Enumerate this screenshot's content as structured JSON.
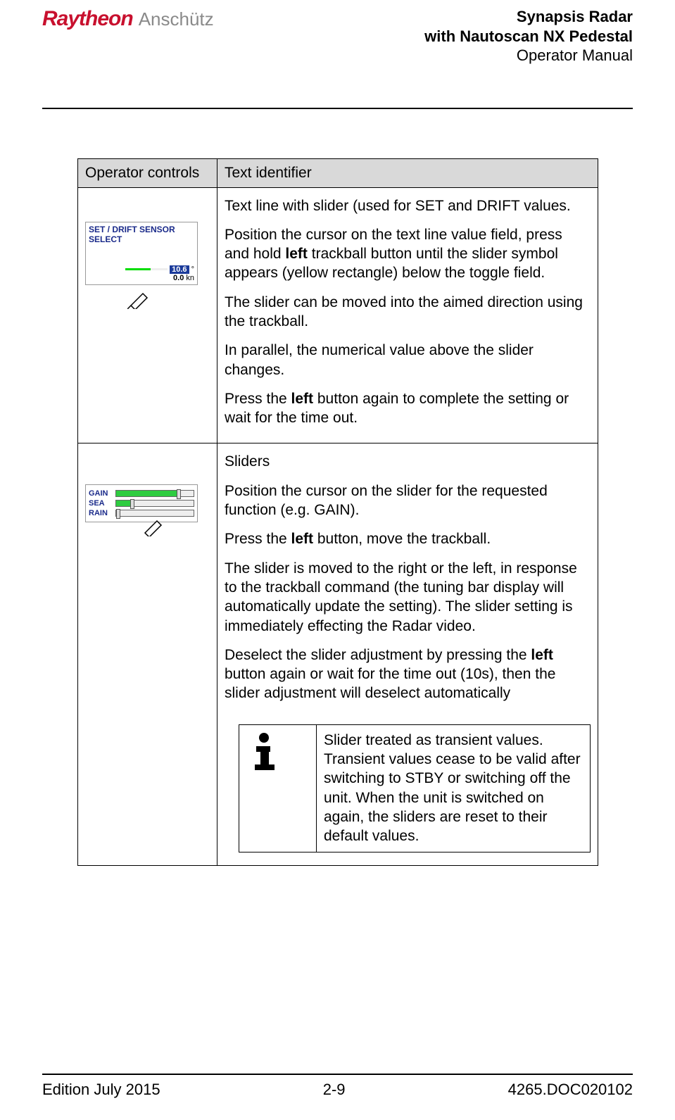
{
  "header": {
    "logo_primary": "Raytheon",
    "logo_secondary": "Anschütz",
    "title_line1": "Synapsis Radar",
    "title_line2": "with Nautoscan NX Pedestal",
    "title_line3": "Operator Manual"
  },
  "table": {
    "head_col1": "Operator controls",
    "head_col2": "Text identifier",
    "row1": {
      "graphic_title": "SET / DRIFT SENSOR SELECT",
      "value_deg": "10.6",
      "unit_deg": "°",
      "value_kn": "0.0",
      "unit_kn": "kn",
      "p1": "Text line with slider (used for SET and DRIFT values.",
      "p2a": "Position the cursor on the text line value field, press and hold ",
      "p2b": "left",
      "p2c": " trackball button until the slider symbol appears (yellow rectangle) below the toggle field.",
      "p3": "The slider can be moved into the aimed direction using the trackball.",
      "p4": "In parallel, the numerical value above the slider changes.",
      "p5a": "Press the ",
      "p5b": "left",
      "p5c": " button again to complete the setting or wait for the time out."
    },
    "row2": {
      "slider_labels": [
        "GAIN",
        "SEA",
        "RAIN"
      ],
      "p1": "Sliders",
      "p2": "Position the cursor on the slider for the requested function (e.g. GAIN).",
      "p3a": "Press the ",
      "p3b": "left",
      "p3c": " button, move the trackball.",
      "p4": "The slider is moved to the right or the left, in response to the trackball command (the tuning bar display will automatically update the setting). The slider setting is immediately effecting the Radar video.",
      "p5a": "Deselect the slider adjustment by pressing the ",
      "p5b": "left",
      "p5c": " button again or wait for the time out (10s), then the slider adjustment will deselect automatically",
      "note": "Slider treated as transient values. Transient values cease to be valid after switching to STBY or switching off the unit. When the unit is switched on again, the sliders are reset to their default values."
    }
  },
  "footer": {
    "left": "Edition July 2015",
    "center": "2-9",
    "right": "4265.DOC020102"
  }
}
